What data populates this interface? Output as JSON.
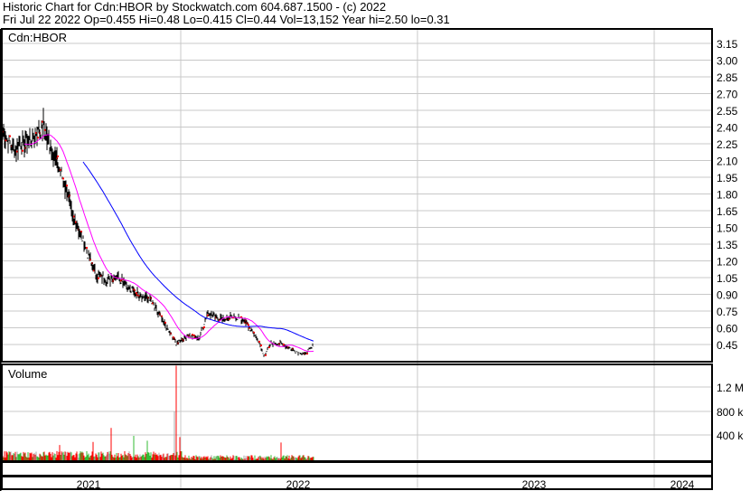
{
  "header": {
    "title": "Historic Chart for Cdn:HBOR by Stockwatch.com 604.687.1500 - (c) 2022",
    "quote": "Fri Jul 22 2022  Op=0.455  Hi=0.48  Lo=0.415  Cl=0.44  Vol=13,152  Year hi=2.50  lo=0.31"
  },
  "colors": {
    "ma_short": "#ff00ff",
    "ma_long": "#0000ff",
    "bar": "#000000",
    "down": "#ff0000",
    "up": "#33bb33",
    "flat": "#aaaaaa",
    "grid": "#c8c8c8"
  },
  "chart_data": [
    {
      "type": "line",
      "title": "Cdn:HBOR",
      "price_ticks": [
        "3.15",
        "3.00",
        "2.85",
        "2.70",
        "2.55",
        "2.40",
        "2.25",
        "2.10",
        "1.95",
        "1.80",
        "1.65",
        "1.50",
        "1.35",
        "1.20",
        "1.05",
        "0.90",
        "0.75",
        "0.60",
        "0.45"
      ],
      "ylim": [
        0.45,
        3.15
      ],
      "x_unit": "trading day index",
      "close_keypoints": [
        [
          0,
          2.36
        ],
        [
          12,
          2.2
        ],
        [
          27,
          2.28
        ],
        [
          45,
          2.4
        ],
        [
          52,
          2.24
        ],
        [
          62,
          2.04
        ],
        [
          72,
          1.8
        ],
        [
          77,
          1.59
        ],
        [
          87,
          1.43
        ],
        [
          97,
          1.19
        ],
        [
          104,
          1.07
        ],
        [
          117,
          1.03
        ],
        [
          127,
          1.07
        ],
        [
          142,
          0.94
        ],
        [
          152,
          0.9
        ],
        [
          162,
          0.86
        ],
        [
          177,
          0.66
        ],
        [
          192,
          0.46
        ],
        [
          207,
          0.54
        ],
        [
          217,
          0.5
        ],
        [
          227,
          0.74
        ],
        [
          242,
          0.68
        ],
        [
          257,
          0.7
        ],
        [
          267,
          0.66
        ],
        [
          282,
          0.5
        ],
        [
          289,
          0.35
        ],
        [
          297,
          0.46
        ],
        [
          307,
          0.46
        ],
        [
          317,
          0.42
        ],
        [
          327,
          0.38
        ],
        [
          334,
          0.36
        ],
        [
          344,
          0.44
        ]
      ],
      "moving_averages": [
        {
          "name": "short MA",
          "period": 25
        },
        {
          "name": "long MA",
          "period": 90
        }
      ],
      "x_labels": [
        "2021",
        "2022",
        "2023",
        "2024"
      ]
    },
    {
      "type": "bar",
      "title": "Volume",
      "volume_ticks": [
        "1.2 M",
        "800 k",
        "400 k"
      ],
      "ylim": [
        0,
        1600000
      ],
      "spikes": [
        [
          120,
          530000
        ],
        [
          145,
          400000
        ],
        [
          160,
          320000
        ],
        [
          190,
          800000
        ],
        [
          192,
          1550000
        ],
        [
          196,
          380000
        ],
        [
          308,
          290000
        ],
        [
          100,
          300000
        ],
        [
          63,
          250000
        ]
      ]
    }
  ]
}
